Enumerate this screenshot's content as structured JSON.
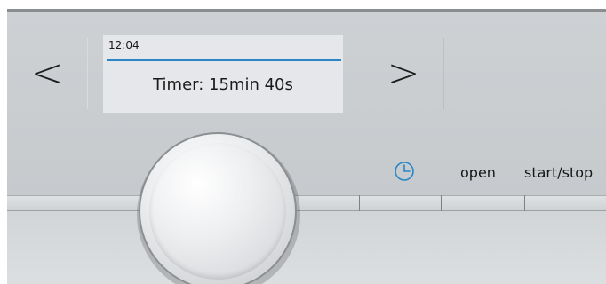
{
  "navigation": {
    "prev_symbol": "<",
    "next_symbol": ">"
  },
  "display": {
    "time": "12:04",
    "message": "Timer: 15min 40s",
    "accent_color": "#2a86c6"
  },
  "controls": {
    "timer_icon": "clock-icon",
    "open_label": "open",
    "start_stop_label": "start/stop"
  },
  "colors": {
    "panel": "#c9cdd0",
    "display_background": "#e5e7ea",
    "accent": "#2a86c6"
  }
}
